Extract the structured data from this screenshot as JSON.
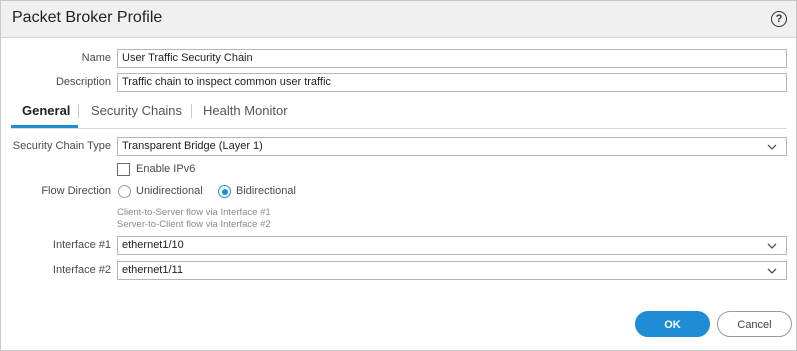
{
  "dialog": {
    "title": "Packet Broker Profile",
    "help_glyph": "?"
  },
  "form": {
    "name_label": "Name",
    "name_value": "User Traffic Security Chain",
    "description_label": "Description",
    "description_value": "Traffic chain to inspect common user traffic"
  },
  "tabs": [
    {
      "label": "General",
      "active": true
    },
    {
      "label": "Security Chains",
      "active": false
    },
    {
      "label": "Health Monitor",
      "active": false
    }
  ],
  "general": {
    "chain_type_label": "Security Chain Type",
    "chain_type_value": "Transparent Bridge (Layer 1)",
    "enable_ipv6_label": "Enable IPv6",
    "enable_ipv6_checked": false,
    "flow_direction_label": "Flow Direction",
    "flow_options": [
      {
        "label": "Unidirectional",
        "selected": false
      },
      {
        "label": "Bidirectional",
        "selected": true
      }
    ],
    "hint_line1": "Client-to-Server flow via Interface #1",
    "hint_line2": "Server-to-Client flow via Interface #2",
    "interface1_label": "Interface #1",
    "interface1_value": "ethernet1/10",
    "interface2_label": "Interface #2",
    "interface2_value": "ethernet1/11"
  },
  "buttons": {
    "ok": "OK",
    "cancel": "Cancel"
  },
  "colors": {
    "accent": "#1f8dd6",
    "titlebar": "#f0f0f0"
  },
  "icons": {
    "help": "help-circle-icon",
    "dropdown": "chevron-down-icon"
  }
}
